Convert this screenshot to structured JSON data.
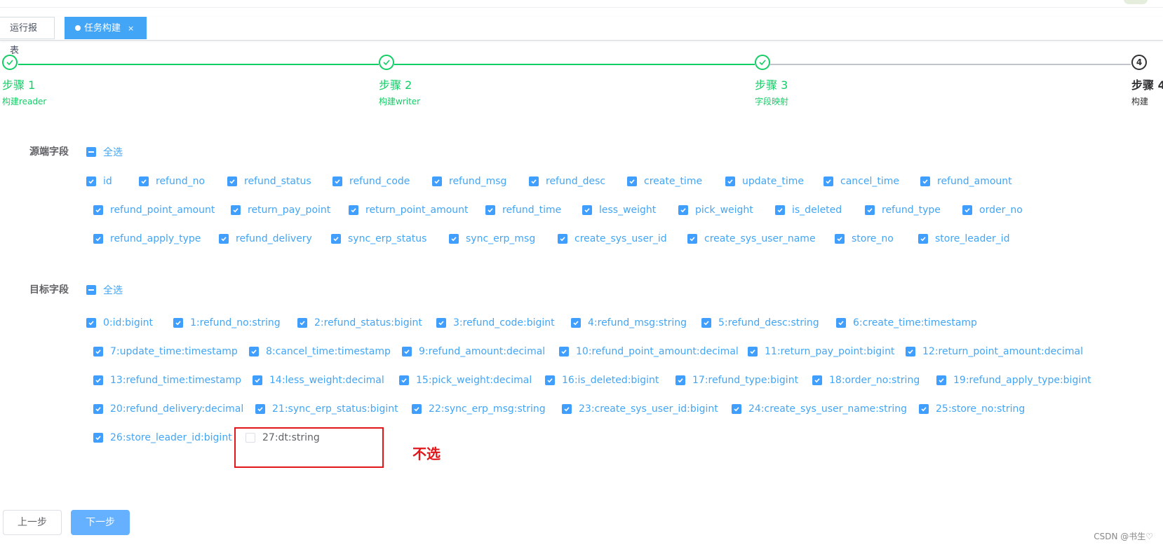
{
  "tabs": [
    {
      "label": "运行报表",
      "active": false
    },
    {
      "label": "任务构建",
      "active": true,
      "close": "×"
    }
  ],
  "steps": [
    {
      "title": "步骤 1",
      "desc": "构建reader",
      "status": "done"
    },
    {
      "title": "步骤 2",
      "desc": "构建writer",
      "status": "done"
    },
    {
      "title": "步骤 3",
      "desc": "字段映射",
      "status": "done"
    },
    {
      "title": "步骤 4",
      "desc": "构建",
      "status": "active",
      "number": "4"
    }
  ],
  "source": {
    "label": "源端字段",
    "select_all": "全选",
    "rows": [
      [
        "id",
        "refund_no",
        "refund_status",
        "refund_code",
        "refund_msg",
        "refund_desc",
        "create_time",
        "update_time",
        "cancel_time",
        "refund_amount"
      ],
      [
        "refund_point_amount",
        "return_pay_point",
        "return_point_amount",
        "refund_time",
        "less_weight",
        "pick_weight",
        "is_deleted",
        "refund_type",
        "order_no"
      ],
      [
        "refund_apply_type",
        "refund_delivery",
        "sync_erp_status",
        "sync_erp_msg",
        "create_sys_user_id",
        "create_sys_user_name",
        "store_no",
        "store_leader_id"
      ]
    ]
  },
  "target": {
    "label": "目标字段",
    "select_all": "全选",
    "rows": [
      [
        "0:id:bigint",
        "1:refund_no:string",
        "2:refund_status:bigint",
        "3:refund_code:bigint",
        "4:refund_msg:string",
        "5:refund_desc:string",
        "6:create_time:timestamp"
      ],
      [
        "7:update_time:timestamp",
        "8:cancel_time:timestamp",
        "9:refund_amount:decimal",
        "10:refund_point_amount:decimal",
        "11:return_pay_point:bigint",
        "12:return_point_amount:decimal"
      ],
      [
        "13:refund_time:timestamp",
        "14:less_weight:decimal",
        "15:pick_weight:decimal",
        "16:is_deleted:bigint",
        "17:refund_type:bigint",
        "18:order_no:string",
        "19:refund_apply_type:bigint"
      ],
      [
        "20:refund_delivery:decimal",
        "21:sync_erp_status:bigint",
        "22:sync_erp_msg:string",
        "23:create_sys_user_id:bigint",
        "24:create_sys_user_name:string",
        "25:store_no:string"
      ],
      [
        "26:store_leader_id:bigint",
        "27:dt:string"
      ]
    ],
    "unchecked": [
      "27:dt:string"
    ]
  },
  "annotation": "不选",
  "buttons": {
    "prev": "上一步",
    "next": "下一步"
  },
  "watermark": "CSDN @书生♡",
  "colors": {
    "primary": "#409eff",
    "success": "#13ce66",
    "annotation": "#e0161b"
  }
}
